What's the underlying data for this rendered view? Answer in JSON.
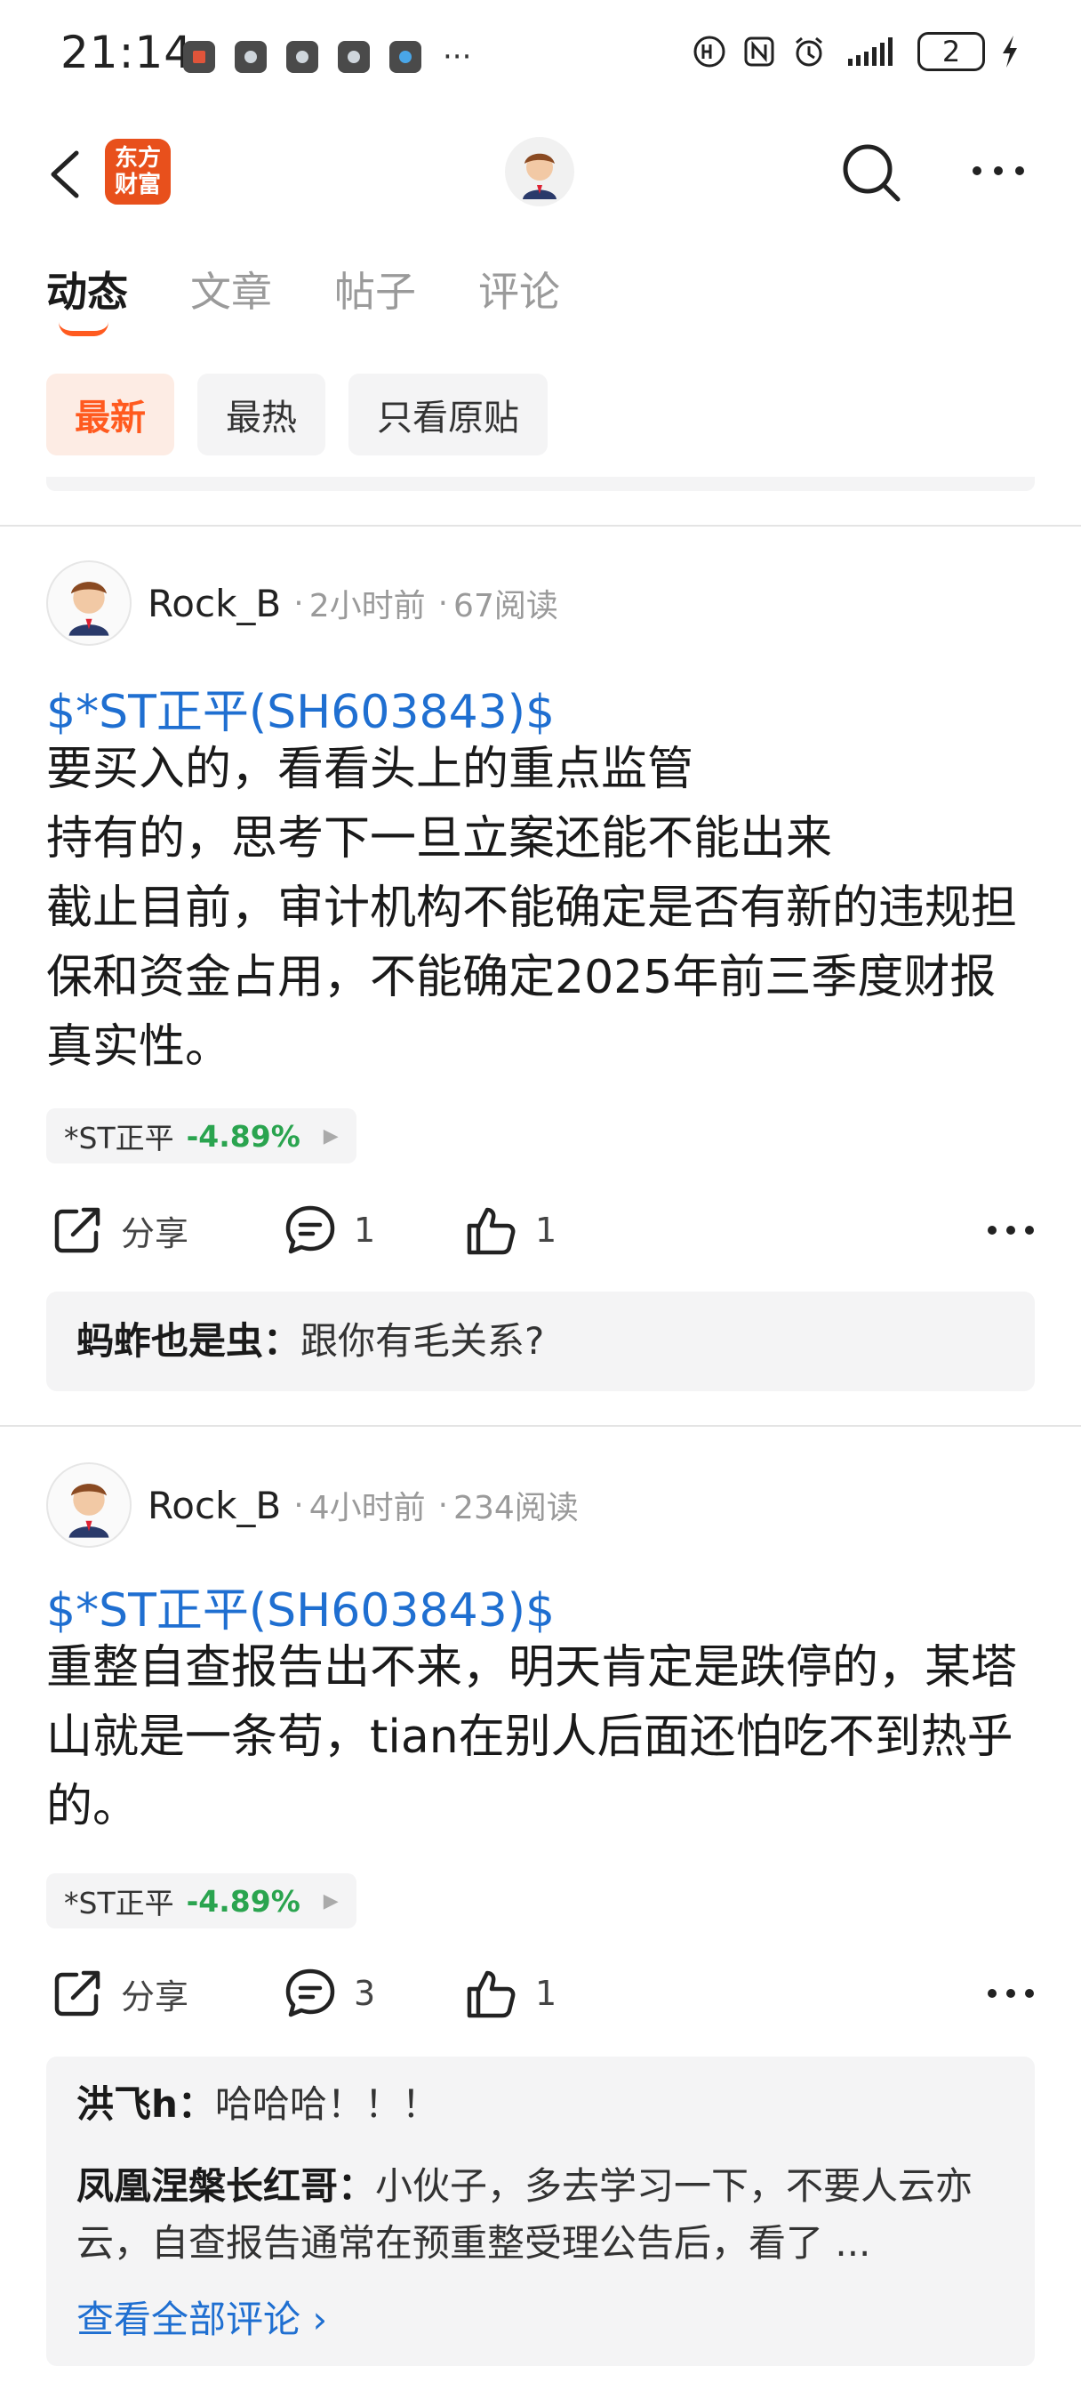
{
  "status": {
    "time": "21:14",
    "more": "···",
    "battery": "2"
  },
  "nav": {
    "brand_logo_line1": "东方",
    "brand_logo_line2": "财富"
  },
  "tabs": [
    "动态",
    "文章",
    "帖子",
    "评论"
  ],
  "filters": [
    "最新",
    "最热",
    "只看原贴"
  ],
  "posts": [
    {
      "author": "Rock_B",
      "time": "2小时前",
      "reads": "67阅读",
      "stock_link": "$*ST正平(SH603843)$",
      "body": "要买入的，看看头上的重点监管\n持有的，思考下一旦立案还能不能出来\n截止目前，审计机构不能确定是否有新的违规担保和资金占用，不能确定2025年前三季度财报真实性。",
      "tag_name": "*ST正平",
      "tag_change": "-4.89%",
      "share_label": "分享",
      "comment_count": "1",
      "like_count": "1",
      "comments": [
        {
          "user": "蚂蚱也是虫：",
          "text": "跟你有毛关系?"
        }
      ]
    },
    {
      "author": "Rock_B",
      "time": "4小时前",
      "reads": "234阅读",
      "stock_link": "$*ST正平(SH603843)$",
      "body": "重整自查报告出不来，明天肯定是跌停的，某塔山就是一条苟，tian在别人后面还怕吃不到热乎的。",
      "tag_name": "*ST正平",
      "tag_change": "-4.89%",
      "share_label": "分享",
      "comment_count": "3",
      "like_count": "1",
      "comments": [
        {
          "user": "洪飞h：",
          "text": "哈哈哈！！！"
        },
        {
          "user": "凤凰涅槃长红哥：",
          "text": "小伙子，多去学习一下，不要人云亦云，自查报告通常在预重整受理公告后，看了 ..."
        }
      ],
      "view_all": "查看全部评论 ›"
    }
  ],
  "colors": {
    "accent": "#ff5a1f",
    "link": "#1f6fd1",
    "down": "#2aa44f",
    "brand": "#e8501c"
  }
}
